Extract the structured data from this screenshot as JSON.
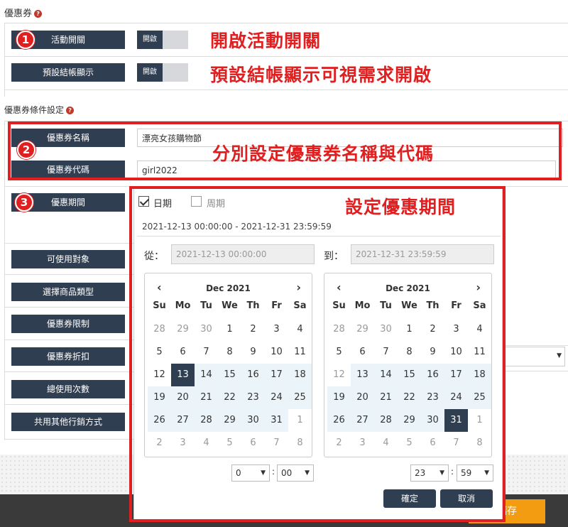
{
  "section1": {
    "title": "優惠券",
    "help_icon": "?"
  },
  "rows": {
    "activity_switch": "活動開關",
    "checkout_display": "預設結帳顯示",
    "toggle_on_label": "開啟"
  },
  "annotations": {
    "note1": "開啟活動開關",
    "note2": "預設結帳顯示可視需求開啟",
    "note3": "分別設定優惠券名稱與代碼",
    "note4": "設定優惠期間",
    "badge1": "1",
    "badge2": "2",
    "badge3": "3"
  },
  "section2": {
    "title": "優惠券條件設定",
    "help_icon": "?"
  },
  "fields": {
    "name_label": "優惠券名稱",
    "name_value": "漂亮女孩購物節",
    "code_label": "優惠券代碼",
    "code_value": "girl2022",
    "period_label": "優惠期間",
    "audience_label": "可使用對象",
    "product_type_label": "選擇商品類型",
    "limit_label": "優惠券限制",
    "discount_label": "優惠券折扣",
    "usage_count_label": "總使用次數",
    "combine_label": "共用其他行銷方式"
  },
  "period": {
    "option_date": "日期",
    "option_cycle": "周期",
    "range_text": "2021-12-13 00:00:00 - 2021-12-31 23:59:59",
    "from_label": "從：",
    "from_value": "2021-12-13 00:00:00",
    "to_label": "到：",
    "to_value": "2021-12-31 23:59:59"
  },
  "calendar_left": {
    "month": "Dec 2021",
    "prev": "‹",
    "next": "›"
  },
  "calendar_right": {
    "month": "Dec 2021",
    "prev": "‹",
    "next": "›"
  },
  "weekdays": [
    "Su",
    "Mo",
    "Tu",
    "We",
    "Th",
    "Fr",
    "Sa"
  ],
  "calendar_weeks": [
    [
      "28",
      "29",
      "30",
      "1",
      "2",
      "3",
      "4"
    ],
    [
      "5",
      "6",
      "7",
      "8",
      "9",
      "10",
      "11"
    ],
    [
      "12",
      "13",
      "14",
      "15",
      "16",
      "17",
      "18"
    ],
    [
      "19",
      "20",
      "21",
      "22",
      "23",
      "24",
      "25"
    ],
    [
      "26",
      "27",
      "28",
      "29",
      "30",
      "31",
      "1"
    ],
    [
      "2",
      "3",
      "4",
      "5",
      "6",
      "7",
      "8"
    ]
  ],
  "time_left": {
    "hour": "0",
    "minute": "00"
  },
  "time_right": {
    "hour": "23",
    "minute": "59"
  },
  "time_sep": ":",
  "buttons": {
    "confirm": "確定",
    "cancel": "取消",
    "save": "儲存"
  },
  "discount_dropdown_arrow": "▼"
}
